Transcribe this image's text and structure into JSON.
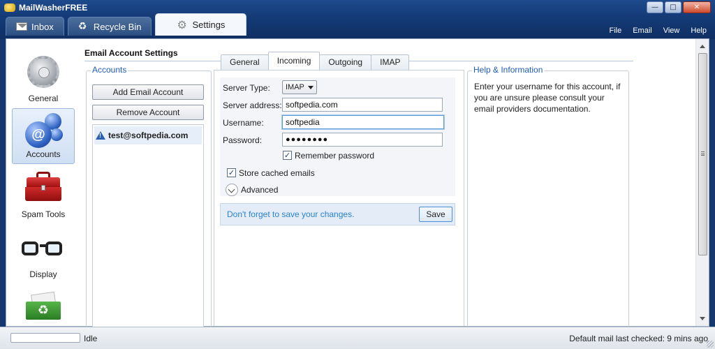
{
  "window": {
    "title": "MailWasherFREE",
    "title_brand": "MailWasher",
    "title_edition": "FREE",
    "controls": {
      "minimize": "—",
      "maximize": "□",
      "close": "✕"
    }
  },
  "tabs": [
    {
      "label": "Inbox",
      "icon": "envelope-icon"
    },
    {
      "label": "Recycle Bin",
      "icon": "recycle-icon"
    },
    {
      "label": "Settings",
      "icon": "gear-icon",
      "active": true
    }
  ],
  "menu": [
    "File",
    "Email",
    "View",
    "Help"
  ],
  "nav": [
    {
      "label": "General",
      "icon": "gear-icon"
    },
    {
      "label": "Accounts",
      "icon": "accounts-icon",
      "active": true
    },
    {
      "label": "Spam Tools",
      "icon": "toolbox-icon"
    },
    {
      "label": "Display",
      "icon": "glasses-icon"
    },
    {
      "label": "",
      "icon": "recycle-bin-icon"
    }
  ],
  "section_title": "Email Account Settings",
  "accounts": {
    "group_title": "Accounts",
    "add_label": "Add Email Account",
    "remove_label": "Remove Account",
    "items": [
      {
        "email": "test@softpedia.com",
        "icon": "warning-icon"
      }
    ]
  },
  "subtabs": [
    {
      "label": "General"
    },
    {
      "label": "Incoming",
      "active": true
    },
    {
      "label": "Outgoing"
    },
    {
      "label": "IMAP"
    }
  ],
  "incoming": {
    "server_type_label": "Server Type:",
    "server_type_value": "IMAP",
    "server_address_label": "Server address:",
    "server_address_value": "softpedia.com",
    "username_label": "Username:",
    "username_value": "softpedia",
    "password_label": "Password:",
    "password_value": "●●●●●●●●",
    "remember_password_label": "Remember password",
    "remember_password_checked": true,
    "store_cached_label": "Store cached emails",
    "store_cached_checked": true,
    "advanced_label": "Advanced",
    "notice": "Don't forget to save your changes.",
    "save_label": "Save"
  },
  "help": {
    "group_title": "Help & Information",
    "text": "Enter your username for this account, if you are unsure please consult your email providers documentation."
  },
  "status": {
    "left": "Idle",
    "right": "Default mail last checked: 9 mins ago"
  },
  "colors": {
    "accent": "#1f5cb8",
    "notice_text": "#2a82d0",
    "title_bar": "#143a76"
  }
}
